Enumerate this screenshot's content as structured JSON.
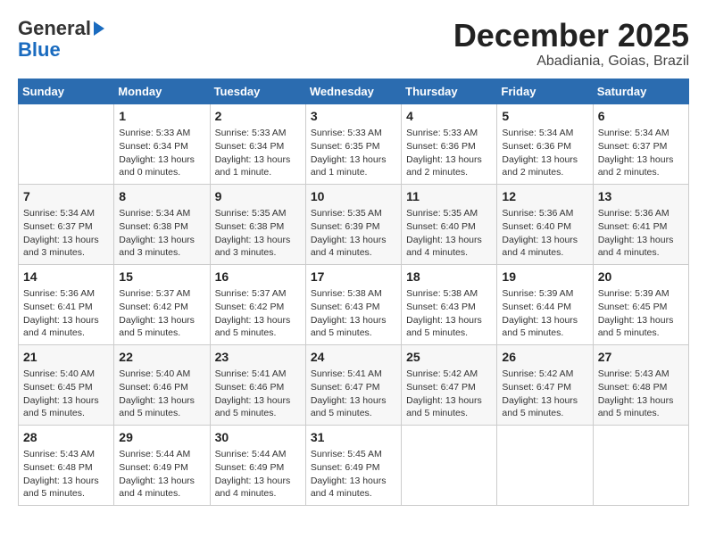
{
  "logo": {
    "general": "General",
    "blue": "Blue"
  },
  "header": {
    "month": "December 2025",
    "location": "Abadiania, Goias, Brazil"
  },
  "days_of_week": [
    "Sunday",
    "Monday",
    "Tuesday",
    "Wednesday",
    "Thursday",
    "Friday",
    "Saturday"
  ],
  "weeks": [
    [
      {
        "day": "",
        "info": ""
      },
      {
        "day": "1",
        "info": "Sunrise: 5:33 AM\nSunset: 6:34 PM\nDaylight: 13 hours\nand 0 minutes."
      },
      {
        "day": "2",
        "info": "Sunrise: 5:33 AM\nSunset: 6:34 PM\nDaylight: 13 hours\nand 1 minute."
      },
      {
        "day": "3",
        "info": "Sunrise: 5:33 AM\nSunset: 6:35 PM\nDaylight: 13 hours\nand 1 minute."
      },
      {
        "day": "4",
        "info": "Sunrise: 5:33 AM\nSunset: 6:36 PM\nDaylight: 13 hours\nand 2 minutes."
      },
      {
        "day": "5",
        "info": "Sunrise: 5:34 AM\nSunset: 6:36 PM\nDaylight: 13 hours\nand 2 minutes."
      },
      {
        "day": "6",
        "info": "Sunrise: 5:34 AM\nSunset: 6:37 PM\nDaylight: 13 hours\nand 2 minutes."
      }
    ],
    [
      {
        "day": "7",
        "info": "Sunrise: 5:34 AM\nSunset: 6:37 PM\nDaylight: 13 hours\nand 3 minutes."
      },
      {
        "day": "8",
        "info": "Sunrise: 5:34 AM\nSunset: 6:38 PM\nDaylight: 13 hours\nand 3 minutes."
      },
      {
        "day": "9",
        "info": "Sunrise: 5:35 AM\nSunset: 6:38 PM\nDaylight: 13 hours\nand 3 minutes."
      },
      {
        "day": "10",
        "info": "Sunrise: 5:35 AM\nSunset: 6:39 PM\nDaylight: 13 hours\nand 4 minutes."
      },
      {
        "day": "11",
        "info": "Sunrise: 5:35 AM\nSunset: 6:40 PM\nDaylight: 13 hours\nand 4 minutes."
      },
      {
        "day": "12",
        "info": "Sunrise: 5:36 AM\nSunset: 6:40 PM\nDaylight: 13 hours\nand 4 minutes."
      },
      {
        "day": "13",
        "info": "Sunrise: 5:36 AM\nSunset: 6:41 PM\nDaylight: 13 hours\nand 4 minutes."
      }
    ],
    [
      {
        "day": "14",
        "info": "Sunrise: 5:36 AM\nSunset: 6:41 PM\nDaylight: 13 hours\nand 4 minutes."
      },
      {
        "day": "15",
        "info": "Sunrise: 5:37 AM\nSunset: 6:42 PM\nDaylight: 13 hours\nand 5 minutes."
      },
      {
        "day": "16",
        "info": "Sunrise: 5:37 AM\nSunset: 6:42 PM\nDaylight: 13 hours\nand 5 minutes."
      },
      {
        "day": "17",
        "info": "Sunrise: 5:38 AM\nSunset: 6:43 PM\nDaylight: 13 hours\nand 5 minutes."
      },
      {
        "day": "18",
        "info": "Sunrise: 5:38 AM\nSunset: 6:43 PM\nDaylight: 13 hours\nand 5 minutes."
      },
      {
        "day": "19",
        "info": "Sunrise: 5:39 AM\nSunset: 6:44 PM\nDaylight: 13 hours\nand 5 minutes."
      },
      {
        "day": "20",
        "info": "Sunrise: 5:39 AM\nSunset: 6:45 PM\nDaylight: 13 hours\nand 5 minutes."
      }
    ],
    [
      {
        "day": "21",
        "info": "Sunrise: 5:40 AM\nSunset: 6:45 PM\nDaylight: 13 hours\nand 5 minutes."
      },
      {
        "day": "22",
        "info": "Sunrise: 5:40 AM\nSunset: 6:46 PM\nDaylight: 13 hours\nand 5 minutes."
      },
      {
        "day": "23",
        "info": "Sunrise: 5:41 AM\nSunset: 6:46 PM\nDaylight: 13 hours\nand 5 minutes."
      },
      {
        "day": "24",
        "info": "Sunrise: 5:41 AM\nSunset: 6:47 PM\nDaylight: 13 hours\nand 5 minutes."
      },
      {
        "day": "25",
        "info": "Sunrise: 5:42 AM\nSunset: 6:47 PM\nDaylight: 13 hours\nand 5 minutes."
      },
      {
        "day": "26",
        "info": "Sunrise: 5:42 AM\nSunset: 6:47 PM\nDaylight: 13 hours\nand 5 minutes."
      },
      {
        "day": "27",
        "info": "Sunrise: 5:43 AM\nSunset: 6:48 PM\nDaylight: 13 hours\nand 5 minutes."
      }
    ],
    [
      {
        "day": "28",
        "info": "Sunrise: 5:43 AM\nSunset: 6:48 PM\nDaylight: 13 hours\nand 5 minutes."
      },
      {
        "day": "29",
        "info": "Sunrise: 5:44 AM\nSunset: 6:49 PM\nDaylight: 13 hours\nand 4 minutes."
      },
      {
        "day": "30",
        "info": "Sunrise: 5:44 AM\nSunset: 6:49 PM\nDaylight: 13 hours\nand 4 minutes."
      },
      {
        "day": "31",
        "info": "Sunrise: 5:45 AM\nSunset: 6:49 PM\nDaylight: 13 hours\nand 4 minutes."
      },
      {
        "day": "",
        "info": ""
      },
      {
        "day": "",
        "info": ""
      },
      {
        "day": "",
        "info": ""
      }
    ]
  ]
}
